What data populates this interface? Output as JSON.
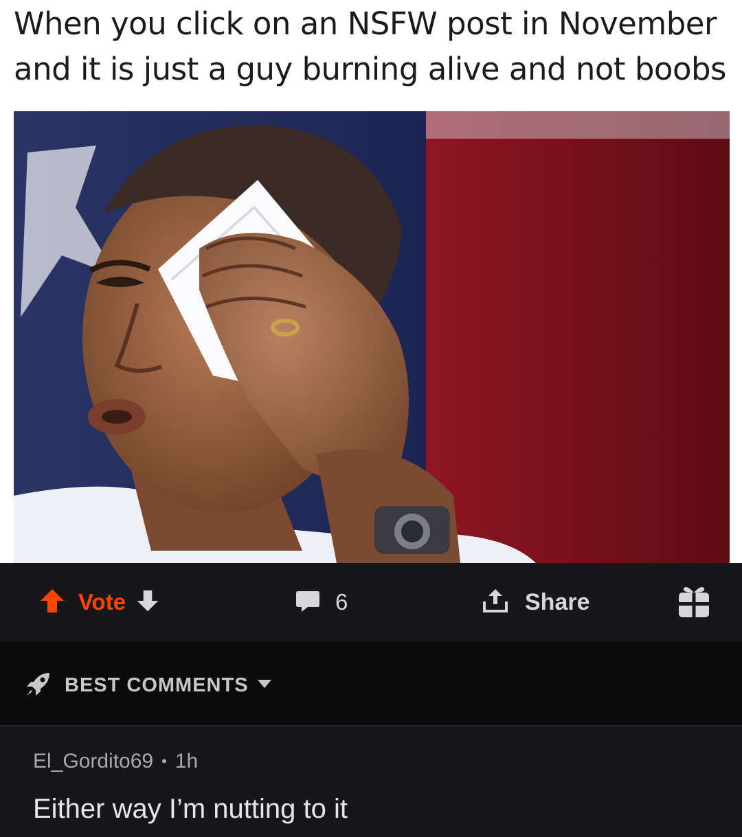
{
  "meme": {
    "caption_line1": "When you click on an NSFW post in November",
    "caption_line2": "and it is just a guy burning alive and not boobs"
  },
  "actions": {
    "vote_label": "Vote",
    "comment_count": "6",
    "share_label": "Share",
    "upvote_icon": "arrow-up-icon",
    "downvote_icon": "arrow-down-icon",
    "comment_icon": "comment-bubble-icon",
    "share_icon": "share-upload-icon",
    "award_icon": "gift-award-icon",
    "accent_color": "#ff4500"
  },
  "sort": {
    "label": "BEST COMMENTS",
    "icon": "rocket-icon",
    "dropdown_icon": "caret-down-icon"
  },
  "comment": {
    "author": "El_Gordito69",
    "separator": "•",
    "age": "1h",
    "body": "Either way I’m nutting to it"
  },
  "colors": {
    "action_bar_bg": "#17171a",
    "sort_bar_bg": "#0b0b0c",
    "text_muted": "#a9a9ae"
  }
}
